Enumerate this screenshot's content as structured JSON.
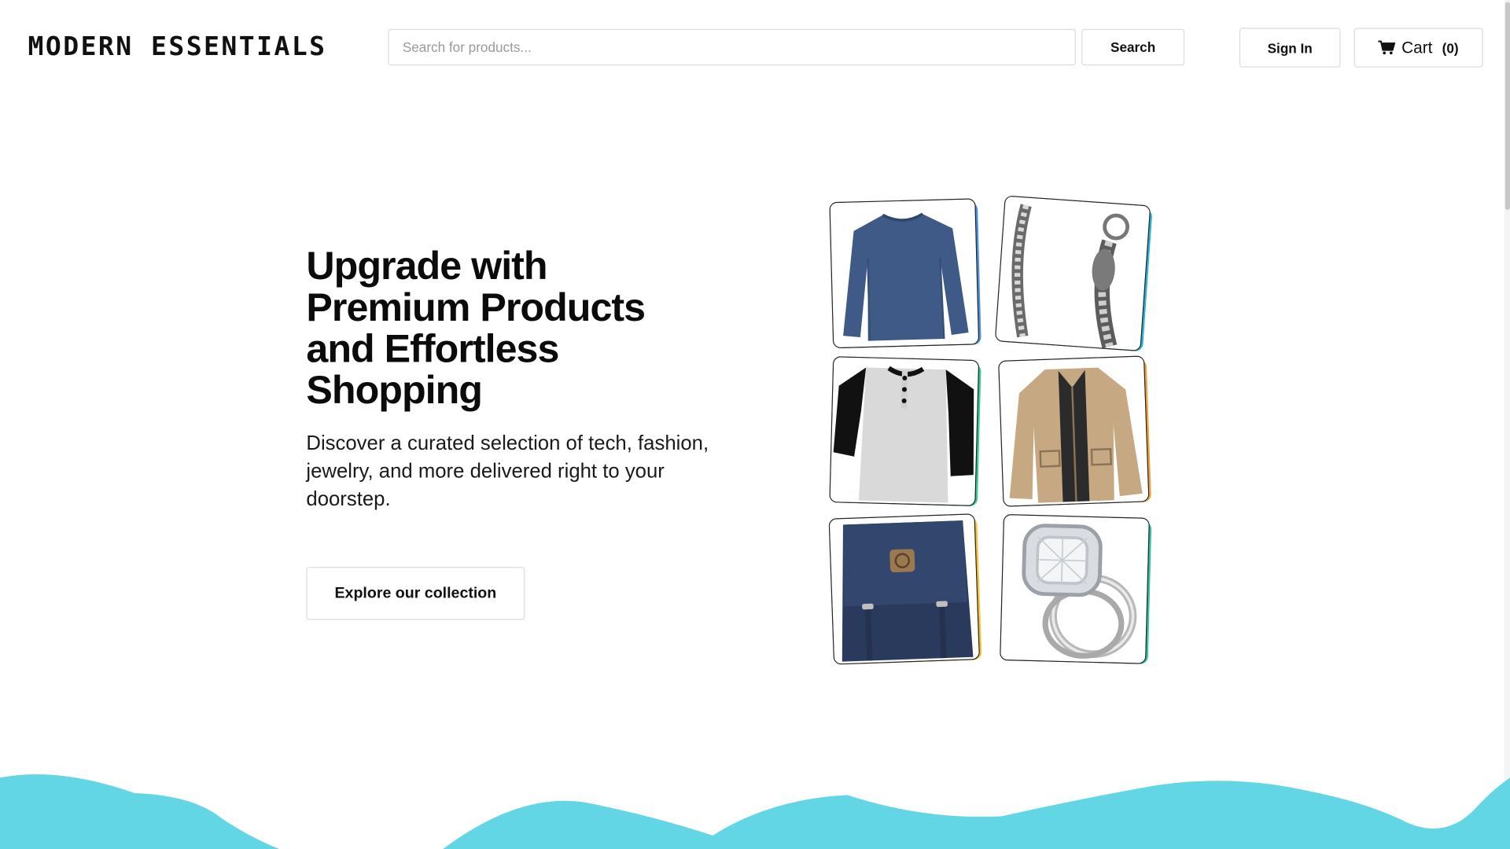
{
  "header": {
    "logo_text": "MODERN ESSENTIALS",
    "search": {
      "placeholder": "Search for products...",
      "value": ""
    },
    "search_button_label": "Search",
    "signin_label": "Sign In",
    "cart": {
      "label": "Cart",
      "count": "(0)",
      "icon": "cart-icon"
    }
  },
  "hero": {
    "title": "Upgrade with Premium Products and Effortless Shopping",
    "subtitle": "Discover a curated selection of tech, fashion, jewelry, and more delivered right to your doorstep.",
    "cta_label": "Explore our collection"
  },
  "products": [
    {
      "name": "blue-long-sleeve-shirt",
      "accent": "#4a90e2"
    },
    {
      "name": "silver-chain-bracelet",
      "accent": "#2bb3d6"
    },
    {
      "name": "raglan-henley-shirt",
      "accent": "#2ecc9a"
    },
    {
      "name": "khaki-jacket",
      "accent": "#f2a23a"
    },
    {
      "name": "navy-backpack",
      "accent": "#f5c430"
    },
    {
      "name": "diamond-ring-set",
      "accent": "#2ec4a0"
    }
  ],
  "colors": {
    "wave": "#63d6e5",
    "text": "#111111",
    "border": "#dcdcdc"
  }
}
